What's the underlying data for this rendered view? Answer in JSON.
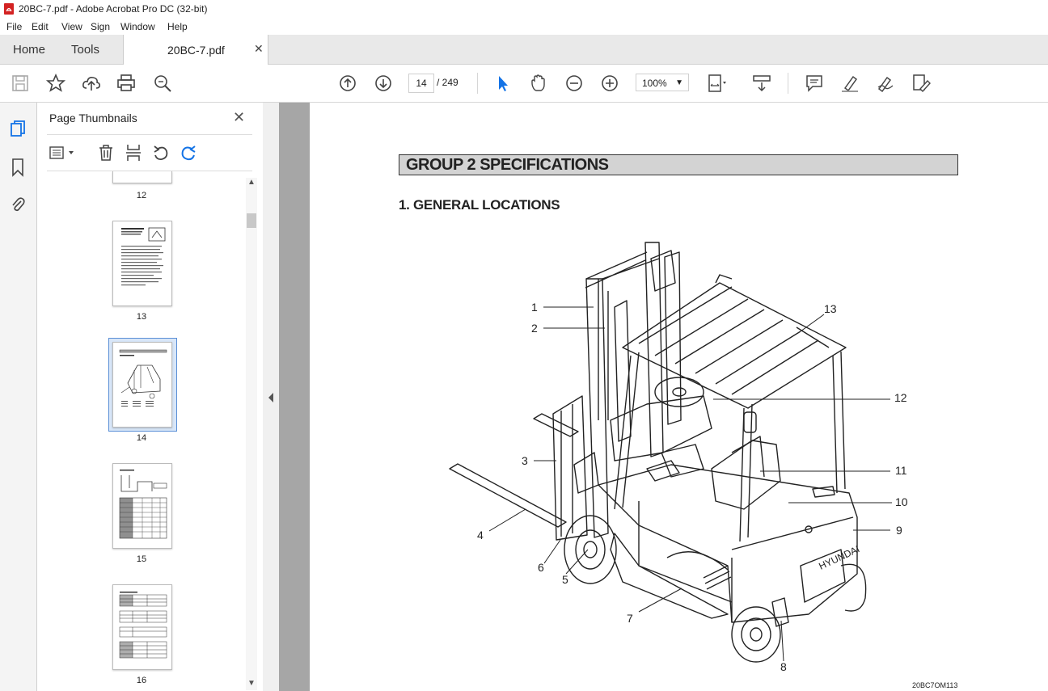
{
  "window": {
    "title": "20BC-7.pdf - Adobe Acrobat Pro DC (32-bit)"
  },
  "menu": [
    "File",
    "Edit",
    "View",
    "Sign",
    "Window",
    "Help"
  ],
  "tabs": {
    "home": "Home",
    "tools": "Tools",
    "document": "20BC-7.pdf"
  },
  "toolbar": {
    "current_page": "14",
    "page_total": "/  249",
    "zoom": "100%",
    "icons": [
      "save-icon",
      "star-icon",
      "upload-icon",
      "print-icon",
      "zoom-search-icon",
      "page-up-icon",
      "page-down-icon",
      "select-cursor-icon",
      "hand-icon",
      "zoom-out-icon",
      "zoom-in-icon",
      "fit-page-icon",
      "scroll-mode-icon",
      "comment-icon",
      "highlight-icon",
      "sign-icon",
      "edit-pdf-icon"
    ]
  },
  "thumbnails_panel": {
    "title": "Page Thumbnails",
    "pages": [
      "12",
      "13",
      "14",
      "15",
      "16"
    ],
    "selected": "14"
  },
  "document": {
    "group_title": "GROUP 2  SPECIFICATIONS",
    "section_title": "1. GENERAL LOCATIONS",
    "figure_code": "20BC7OM113",
    "callouts": [
      "1",
      "2",
      "3",
      "4",
      "5",
      "6",
      "7",
      "8",
      "9",
      "10",
      "11",
      "12",
      "13"
    ]
  },
  "colors": {
    "accent": "#1473e6",
    "pdf_red": "#d32222"
  }
}
